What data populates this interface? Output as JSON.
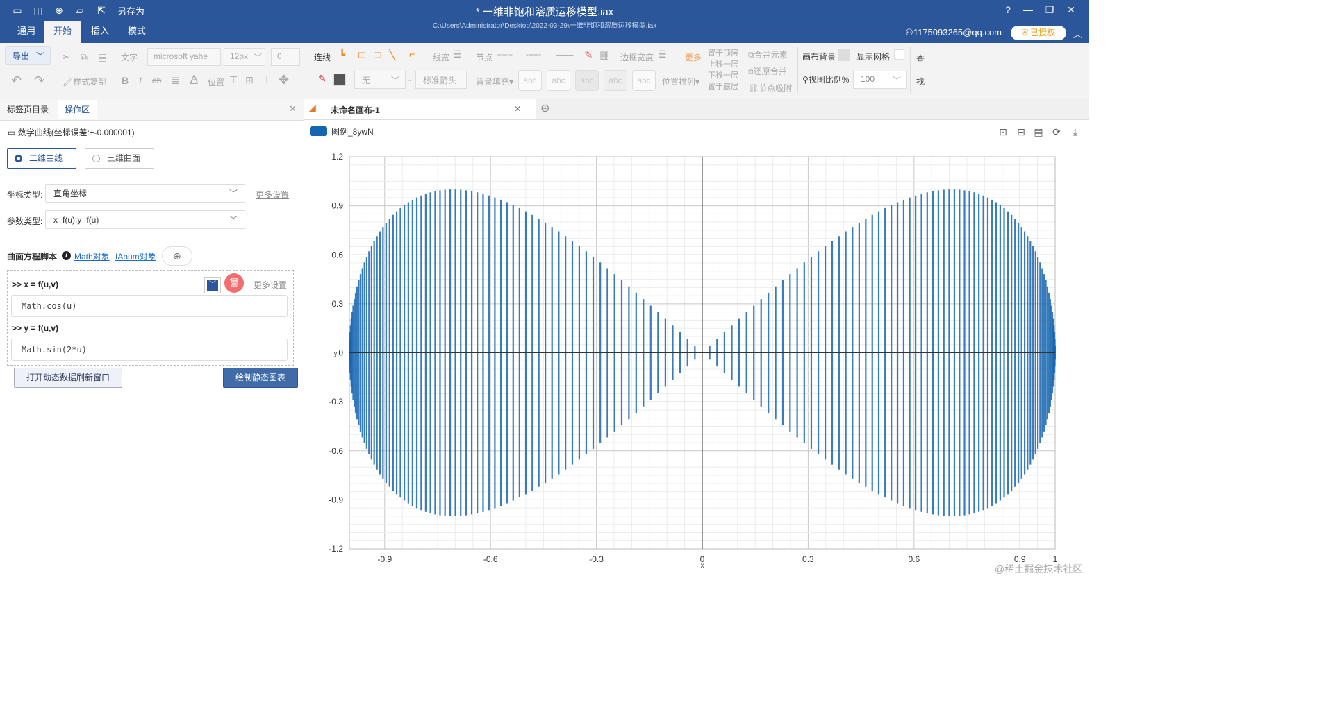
{
  "titlebar": {
    "save_as": "另存为",
    "doc_title": "* 一维非饱和溶质运移模型.iax",
    "doc_path": "C:\\Users\\Administrator\\Desktop\\2022-03-29\\一维非饱和溶质运移模型.iax",
    "user": "1175093265@qq.com",
    "licensed": "已授权",
    "menu_tabs": [
      "通用",
      "开始",
      "插入",
      "模式"
    ]
  },
  "ribbon": {
    "export": "导出",
    "text_label": "文字",
    "font_family": "microsoft yahe",
    "font_size": "12px",
    "weight": "0",
    "style_copy": "样式复制",
    "position": "位置",
    "connect": "连线",
    "line_width": "线宽",
    "node": "节点",
    "border_width": "边框宽度",
    "more": "更多",
    "layer_top": "置于顶层",
    "layer_up": "上移一层",
    "layer_down": "下移一层",
    "layer_bottom": "置于底层",
    "merge": "合并元素",
    "unmerge": "还原合并",
    "node_snap": "节点吸附",
    "canvas_bg": "画布背景",
    "show_grid": "显示网格",
    "view_scale": "视图比例%",
    "view_scale_value": "100",
    "none": "无",
    "arrow": "标准箭头",
    "bg_fill": "背景填充",
    "pos_arrange": "位置排列",
    "abc": "abc",
    "find1": "查",
    "find2": "找"
  },
  "left": {
    "tabs": [
      "标签页目录",
      "操作区"
    ],
    "header": "数学曲线(坐标误差:±-0.000001)",
    "radio_2d": "二维曲线",
    "radio_3d": "三维曲面",
    "coord_label": "坐标类型:",
    "coord_value": "直角坐标",
    "param_label": "参数类型:",
    "param_value": "x=f(u);y=f(u)",
    "more_settings": "更多设置",
    "script_label": "曲面方程脚本",
    "math_link": "Math对象",
    "ianum_link": "IAnum对象",
    "x_label": ">> x = f(u,v)",
    "x_code": "Math.cos(u)",
    "y_label": ">> y = f(u,v)",
    "y_code": "Math.sin(2*u)",
    "open_dyn_btn": "打开动态数据刷新窗口",
    "draw_btn": "绘制静态图表"
  },
  "canvas": {
    "tab_title": "未命名画布-1",
    "legend": "图例_8ywN",
    "watermark": "@稀土掘金技术社区"
  },
  "chart_data": {
    "type": "line",
    "series": [
      {
        "name": "图例_8ywN",
        "x_expr": "Math.cos(u)",
        "y_expr": "Math.sin(2*u)",
        "style": "vertical bars from axis"
      }
    ],
    "xlabel": "x",
    "ylabel": "y",
    "xlim": [
      -1,
      1
    ],
    "ylim": [
      -1.2,
      1.2
    ],
    "x_ticks": [
      "-0.9",
      "-0.6",
      "-0.3",
      "0",
      "0.3",
      "0.6",
      "0.9",
      "1"
    ],
    "y_ticks": [
      "1.2",
      "0.9",
      "0.6",
      "0.3",
      "0",
      "-0.3",
      "-0.6",
      "-0.9",
      "-1.2"
    ],
    "grid": true,
    "color": "#1565b0"
  }
}
